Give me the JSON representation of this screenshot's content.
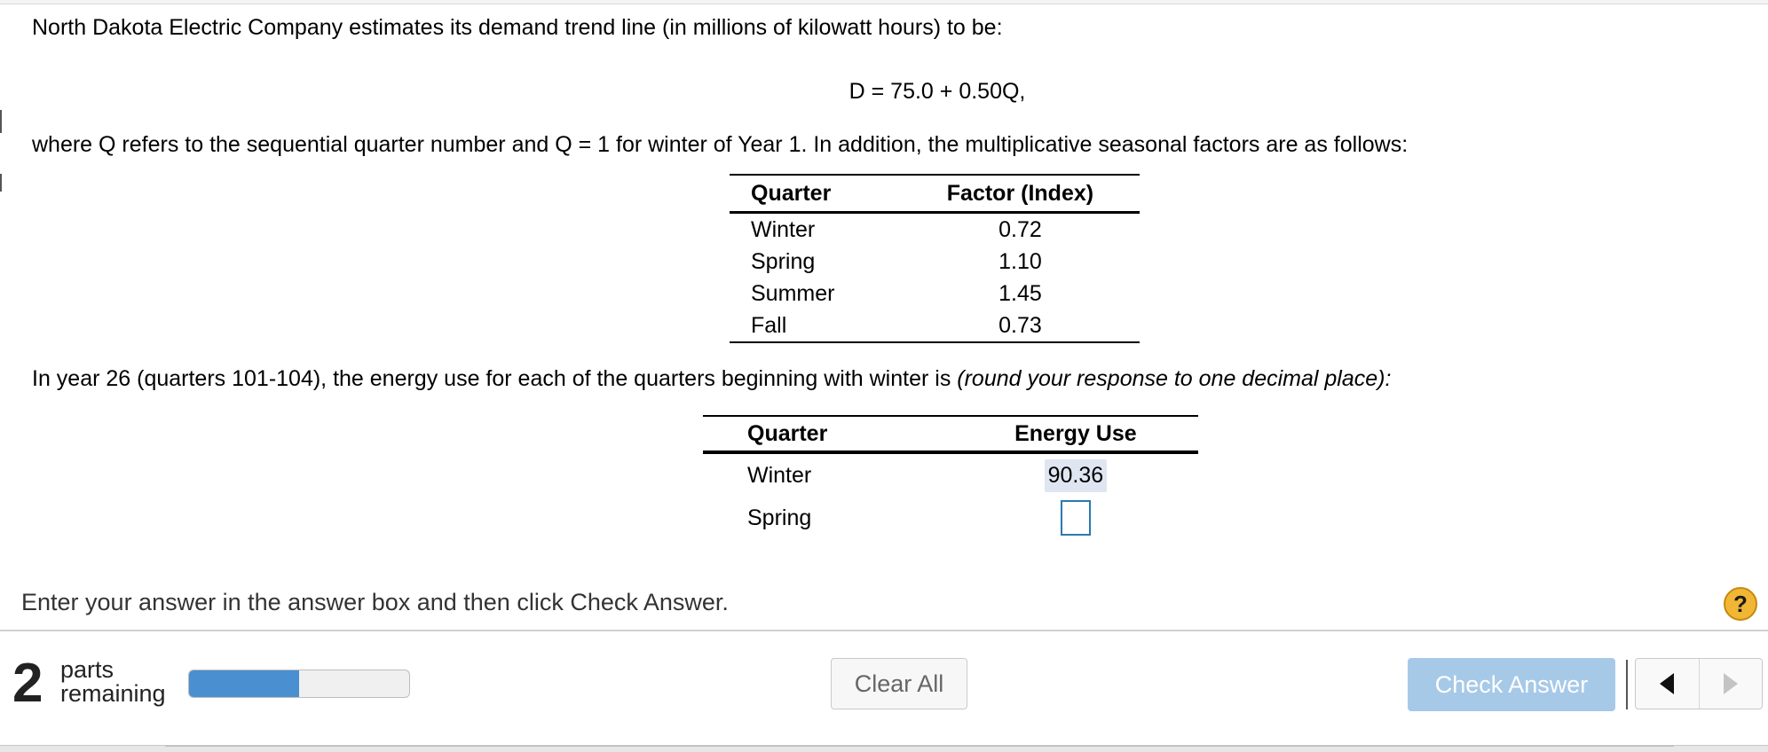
{
  "question": {
    "intro": "North Dakota Electric Company estimates its demand trend line (in millions of kilowatt hours) to be:",
    "equation": "D = 75.0 + 0.50Q,",
    "context": "where Q refers to the sequential quarter number and Q = 1 for winter of Year 1. In addition, the multiplicative seasonal factors are as follows:",
    "factor_table": {
      "headers": [
        "Quarter",
        "Factor (Index)"
      ],
      "rows": [
        {
          "quarter": "Winter",
          "factor": "0.72"
        },
        {
          "quarter": "Spring",
          "factor": "1.10"
        },
        {
          "quarter": "Summer",
          "factor": "1.45"
        },
        {
          "quarter": "Fall",
          "factor": "0.73"
        }
      ]
    },
    "prompt_main": "In year 26 (quarters 101-104), the energy use for each of the quarters beginning with winter is ",
    "prompt_italic": "(round your response to one decimal place):",
    "energy_table": {
      "headers": [
        "Quarter",
        "Energy Use"
      ],
      "rows": [
        {
          "quarter": "Winter",
          "value": "90.36"
        },
        {
          "quarter": "Spring",
          "value": ""
        }
      ]
    }
  },
  "footer": {
    "instruction": "Enter your answer in the answer box and then click Check Answer.",
    "help_glyph": "?",
    "parts_count": "2",
    "parts_label_line1": "parts",
    "parts_label_line2": "remaining",
    "progress_fraction": 0.5,
    "clear_all_label": "Clear All",
    "check_answer_label": "Check Answer",
    "prev_icon": "left-triangle-icon",
    "next_icon": "right-triangle-icon"
  },
  "colors": {
    "progress_fill": "#4a8fcf",
    "check_button": "#a7c9e8",
    "help_badge": "#f1b634",
    "answer_box_border": "#2a7ab0",
    "filled_answer_bg": "#dfe6f1"
  }
}
